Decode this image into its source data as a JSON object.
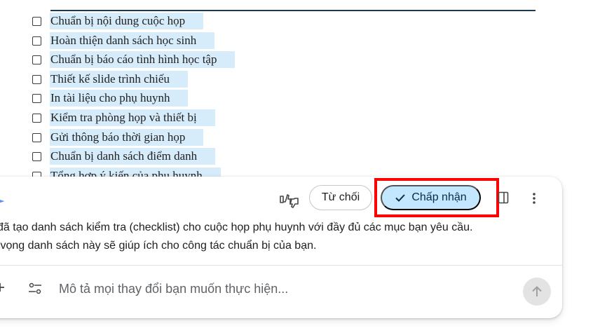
{
  "document": {
    "checklist": [
      {
        "label": "Chuẩn bị nội dung cuộc họp"
      },
      {
        "label": "Hoàn thiện danh sách học sinh"
      },
      {
        "label": "Chuẩn bị báo cáo tình hình học tập"
      },
      {
        "label": "Thiết kế slide trình chiếu"
      },
      {
        "label": "In tài liệu cho phụ huynh"
      },
      {
        "label": "Kiểm tra phòng họp và thiết bị"
      },
      {
        "label": "Gửi thông báo thời gian họp"
      },
      {
        "label": "Chuẩn bị danh sách điểm danh"
      },
      {
        "label": "Tổng hợp ý kiến của phụ huynh"
      }
    ]
  },
  "assistant_panel": {
    "actions": {
      "feedback_icon": "thumbs-up-down-icon",
      "reject_label": "Từ chối",
      "accept_label": "Chấp nhận",
      "accept_icon": "check-icon",
      "side_panel_icon": "side-panel-icon",
      "more_icon": "more-vert-icon"
    },
    "message": {
      "line1": "i đã tạo danh sách kiểm tra (checklist) cho cuộc họp phụ huynh với đầy đủ các mục bạn yêu cầu.",
      "line2": "y vọng danh sách này sẽ giúp ích cho công tác chuẩn bị của bạn."
    },
    "composer": {
      "placeholder": "Mô tả mọi thay đổi bạn muốn thực hiện...",
      "value": "",
      "add_icon": "plus-icon",
      "tools_icon": "tune-icon",
      "send_icon": "arrow-up-icon"
    }
  },
  "colors": {
    "selection_highlight": "#d7ecfb",
    "accept_button_bg": "#c2e7ff",
    "annotation_box": "#ff0000",
    "send_button_bg": "#e3e3e3"
  }
}
